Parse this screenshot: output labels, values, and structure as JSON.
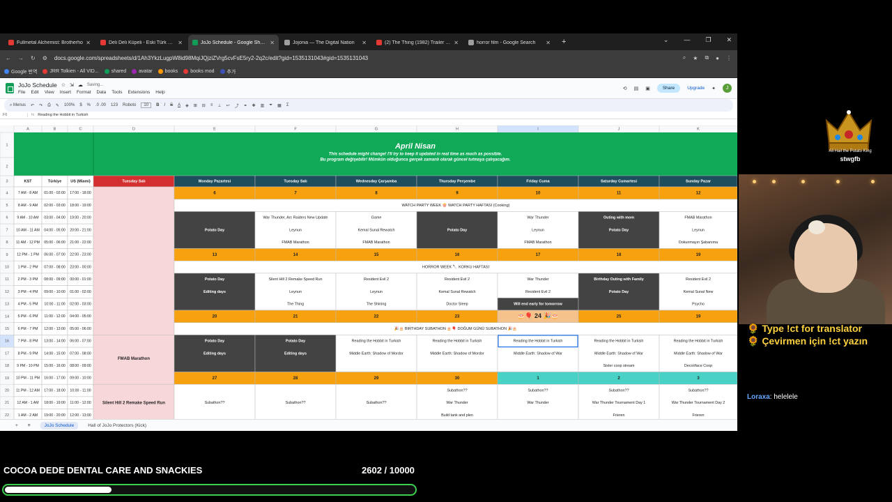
{
  "browser": {
    "tabs": [
      {
        "label": "Fullmetal Alchemist: Brotherho",
        "color": "#e53935",
        "active": false
      },
      {
        "label": "Deli Deli Küpeli - Eski Türk Film",
        "color": "#e53935",
        "active": false
      },
      {
        "label": "JoJo Schedule - Google Sheets",
        "color": "#0f9d58",
        "active": true
      },
      {
        "label": "Jojonia — The Digital Nation",
        "color": "#9e9e9e",
        "active": false
      },
      {
        "label": "(2) The Thing (1982) Trailer - Yo",
        "color": "#e53935",
        "active": false
      },
      {
        "label": "horror film - Google Search",
        "color": "#9e9e9e",
        "active": false
      }
    ],
    "new_tab": "+",
    "url": "docs.google.com/spreadsheets/d/1Ah3YkzLugpW8id98MqiJQjziZVrg5cvFsE5ry2-2q2c/edit?gid=1535131043#gid=1535131043",
    "bookmarks": [
      "Google 번역",
      "JRR Tolkien - All VID...",
      "shared",
      "avatar",
      "books",
      "books mod",
      "추가"
    ]
  },
  "sheets": {
    "title": "JoJo Schedule",
    "saving": "Saving...",
    "menus": [
      "File",
      "Edit",
      "View",
      "Insert",
      "Format",
      "Data",
      "Tools",
      "Extensions",
      "Help"
    ],
    "share": "Share",
    "upgrade": "Upgrade",
    "avatar_letter": "J",
    "toolbar": {
      "menus": "Menus",
      "zoom": "100%",
      "currency": "$",
      "percent": "%",
      "decimals": ".0  .00",
      "numfmt": "123",
      "font": "Roboto",
      "size": "10"
    },
    "namebox": "F6",
    "formula": "Reading the Hobbit in Turkish",
    "sheet_tabs": [
      "JoJo Schedule",
      "Hall of JoJo Protectors (Kick)"
    ]
  },
  "grid": {
    "col_letters": [
      "A",
      "B",
      "C",
      "D",
      "E",
      "F",
      "G",
      "H",
      "I",
      "J",
      "K"
    ],
    "row_numbers": [
      "1",
      "2",
      "3",
      "4",
      "5",
      "6",
      "7",
      "8",
      "9",
      "10",
      "11",
      "12",
      "13",
      "14",
      "15",
      "16",
      "17",
      "18",
      "19",
      "20",
      "21",
      "22"
    ],
    "banner_title": "April Nisan",
    "banner_sub1": "This schedule might change! I'll try to keep it updated in real time as much as possible.",
    "banner_sub2": "Bu program değişebilir! Mümkün olduğunca gerçek zamanlı olarak güncel tutmaya çalışacağım.",
    "headers": [
      "KST",
      "Türkiye",
      "US (Miami)",
      "Tuesday Salı",
      "Monday Pazartesi",
      "Tuesday Salı",
      "Wednesday Çarşamba",
      "Thursday Perşembe",
      "Friday Cuma",
      "Saturday Cumartesi",
      "Sunday Pazar"
    ],
    "times": [
      [
        "7 AM - 8 AM",
        "01:00 - 02:00",
        "17:00 - 18:00"
      ],
      [
        "8 AM - 9 AM",
        "02:00 - 03:00",
        "18:00 - 19:00"
      ],
      [
        "9 AM - 10 AM",
        "03:00 - 04:00",
        "19:00 - 20:00"
      ],
      [
        "10 AM - 11 AM",
        "04:00 - 05:00",
        "20:00 - 21:00"
      ],
      [
        "11 AM - 12 PM",
        "05:00 - 06:00",
        "21:00 - 22:00"
      ],
      [
        "12 PM - 1 PM",
        "06:00 - 07:00",
        "22:00 - 23:00"
      ],
      [
        "1 PM - 2 PM",
        "07:00 - 08:00",
        "23:00 - 00:00"
      ],
      [
        "2 PM - 3 PM",
        "08:00 - 09:00",
        "00:00 - 01:00"
      ],
      [
        "3 PM - 4 PM",
        "09:00 - 10:00",
        "01:00 - 02:00"
      ],
      [
        "4 PM - 5 PM",
        "10:00 - 11:00",
        "02:00 - 03:00"
      ],
      [
        "5 PM - 6 PM",
        "11:00 - 12:00",
        "04:00 - 05:00"
      ],
      [
        "6 PM - 7 PM",
        "12:00 - 13:00",
        "05:00 - 06:00"
      ],
      [
        "7 PM - 8 PM",
        "13:00 - 14:00",
        "06:00 - 07:00"
      ],
      [
        "8 PM - 9 PM",
        "14:00 - 15:00",
        "07:00 - 08:00"
      ],
      [
        "9 PM - 10 PM",
        "15:00 - 16:00",
        "08:00 - 09:00"
      ],
      [
        "10 PM - 11 PM",
        "16:00 - 17:00",
        "09:00 - 10:00"
      ],
      [
        "11 PM - 12 AM",
        "17:00 - 18:00",
        "10:00 - 11:00"
      ],
      [
        "12 AM - 1 AM",
        "18:00 - 19:00",
        "11:00 - 12:00"
      ],
      [
        "1 AM - 2 AM",
        "19:00 - 20:00",
        "12:00 - 13:00"
      ]
    ],
    "week1_dates": [
      "6",
      "7",
      "8",
      "9",
      "10",
      "11",
      "12"
    ],
    "week2_dates": [
      "13",
      "14",
      "15",
      "16",
      "17",
      "18",
      "19"
    ],
    "week3_dates": [
      "20",
      "21",
      "22",
      "23",
      "🎂🎈 24 🎉🎂",
      "25",
      "19"
    ],
    "week4_dates": [
      "27",
      "28",
      "29",
      "30",
      "1",
      "2",
      "3"
    ],
    "week1_theme": "WATCH PARTY WEEK 🍿 WATCH PARTY HAFTASI (Cooking)",
    "week2_theme": "HORROR WEEK 🔪 KORKU HAFTASI",
    "week3_theme": "🎉🎂 BIRTHDAY SUBATHON 🎂🎈 DOĞUM GÜNÜ SUBATHON 🎉🎂",
    "week1": {
      "mon": "Potato Day",
      "tue": [
        "War Thunder, Arc Raiders New Update",
        "Leynun",
        "FMAB Marathon"
      ],
      "wed": [
        "Game",
        "Kemal Sunal Rewatch",
        "FMAB Marathon"
      ],
      "thu": "Potato Day",
      "fri": [
        "War Thunder",
        "Leynun",
        "FMAB Marathon"
      ],
      "sat": [
        "Outing with mom",
        "Potato Day"
      ],
      "sun": [
        "FMAB Marathon",
        "Leynun",
        "Dokunmayın Şabanıma"
      ]
    },
    "week2": {
      "mon": [
        "Potato Day",
        "Editing days"
      ],
      "tue": [
        "Silent Hill 2 Remake Speed Run",
        "Leynun",
        "The Thing"
      ],
      "wed": [
        "Resident Evil 2",
        "Leynun",
        "The Shining"
      ],
      "thu": [
        "Resident Evil 2",
        "Kemal Sunal Rewatch",
        "Doctor Sleep"
      ],
      "fri": [
        "War Thunder",
        "Resident Evil 2",
        "Will end early for tomorrow"
      ],
      "sat": [
        "Birthday Outing with Family",
        "Potato Day"
      ],
      "sun": [
        "Resident Evil 2",
        "Kemal Sunal New",
        "Psycho"
      ]
    },
    "week3": {
      "mon": [
        "Potato Day",
        "Editing days"
      ],
      "tue": [
        "Potato Day",
        "Editing days"
      ],
      "wed": [
        "Reading the Hobbit in Turkish",
        "Middle Earth: Shadow of Mordor"
      ],
      "thu": [
        "Reading the Hobbit in Turkish",
        "Middle Earth: Shadow of Mordor"
      ],
      "fri": [
        "Reading the Hobbit in Turkish",
        "Middle Earth: Shadow of War"
      ],
      "sat": [
        "Reading the Hobbit in Turkish",
        "Middle Earth: Shadow of War",
        "Sister coop stream"
      ],
      "sun": [
        "Reading the Hobbit in Turkish",
        "Middle Earth: Shadow of War",
        "Decoöface Coop"
      ]
    },
    "week4": {
      "mon": [
        "Subathon??"
      ],
      "tue": [
        "Subathon??"
      ],
      "wed": [
        "Subathon??"
      ],
      "thu": [
        "Subathon??",
        "War Thunder",
        "Build tank and plen"
      ],
      "fri": [
        "Subathon??",
        "War Thunder"
      ],
      "sat": [
        "Subathon??",
        "War Thunder Tournament Day 1",
        "Frieren"
      ],
      "sun": [
        "Subathon??",
        "War Thunder Tournament Day 2",
        "Frieren"
      ]
    },
    "side_fmab": "FMAB Marathon",
    "side_sh2": "Silent Hill 2 Remake Speed Run"
  },
  "overlay": {
    "crown_caption": "All Hail the Potato King",
    "crown_name": "stwgfb",
    "translator_en": "🌻 Type !ct for translator",
    "translator_tr": "🌻 Çevirmen için !ct yazın",
    "chat_user": "Loraxa",
    "chat_message": ": helelele",
    "goal_title": "COCOA DEDE DENTAL CARE AND SNACKIES",
    "goal_count": "2602 / 10000",
    "goal_progress": 0.2602
  },
  "colors": {
    "green": "#0fa958",
    "teal": "#1e4d5c",
    "red": "#d32f2f",
    "orange": "#f6a10d",
    "dark": "#434343",
    "pink": "#f8d7da",
    "cyan": "#48d1c5",
    "peach": "#f6c28b"
  }
}
